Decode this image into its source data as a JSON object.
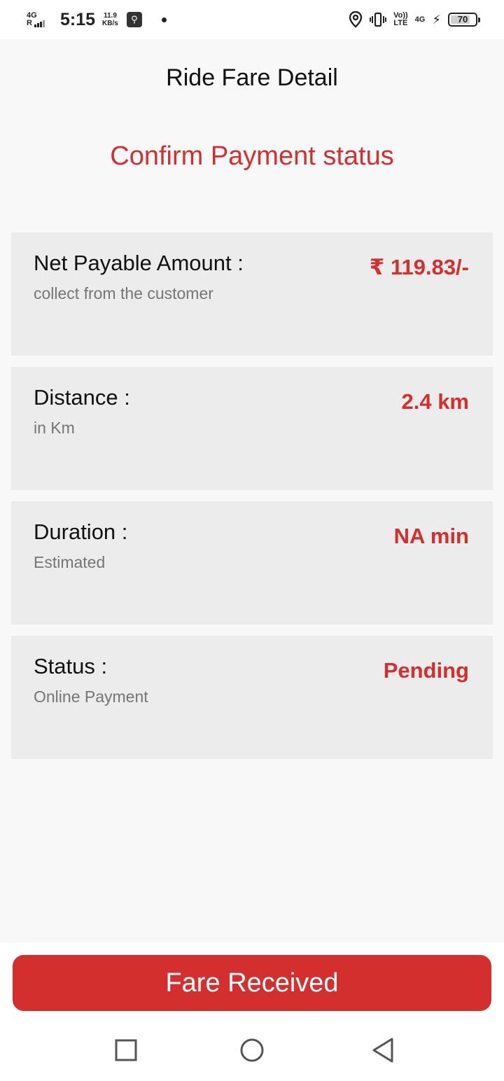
{
  "status_bar": {
    "network_type": "4G",
    "network_roaming": "R",
    "time": "5:15",
    "speed_value": "11.9",
    "speed_unit": "KB/s",
    "volte_top": "Vo))",
    "volte_bottom": "LTE",
    "data_type": "4G",
    "battery_level": "70"
  },
  "header": {
    "title": "Ride Fare Detail",
    "subtitle": "Confirm Payment status"
  },
  "cards": [
    {
      "label": "Net Payable Amount :",
      "sub": "collect from the customer",
      "value": "₹ 119.83/-"
    },
    {
      "label": "Distance :",
      "sub": "in Km",
      "value": "2.4 km"
    },
    {
      "label": "Duration :",
      "sub": "Estimated",
      "value": "NA min"
    },
    {
      "label": "Status :",
      "sub": "Online Payment",
      "value": "Pending"
    }
  ],
  "actions": {
    "fare_received_label": "Fare Received"
  },
  "colors": {
    "accent": "#d32f2f",
    "card_bg": "#ececec",
    "screen_bg": "#f8f8f8"
  },
  "icons": {
    "usb": "usb-debug-icon",
    "location": "location-icon",
    "vibrate": "vibrate-icon",
    "charging": "charging-bolt-icon",
    "recents": "recents-square-icon",
    "home": "home-circle-icon",
    "back": "back-triangle-icon"
  }
}
